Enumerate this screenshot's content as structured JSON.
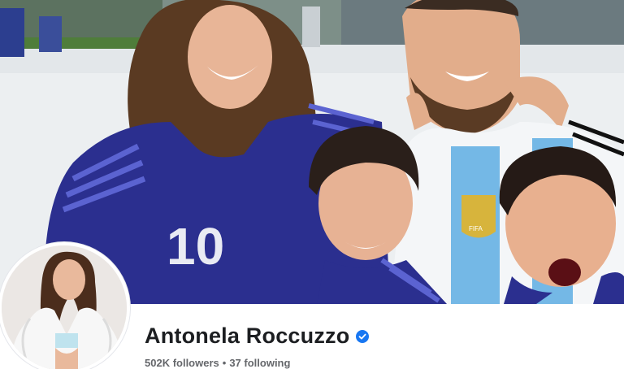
{
  "profile": {
    "name": "Antonela Roccuzzo",
    "verified": true,
    "followers": "502K followers",
    "separator": "•",
    "following": "37 following"
  },
  "cover_photo": {
    "shirt_number": "10"
  },
  "colors": {
    "verified_badge": "#1877f2",
    "name_text": "#1c1e21",
    "secondary_text": "#65676b",
    "jersey_navy": "#2b2f8f",
    "jersey_sky": "#74b8e6"
  },
  "icons": {
    "verified": "verified-badge-icon"
  }
}
